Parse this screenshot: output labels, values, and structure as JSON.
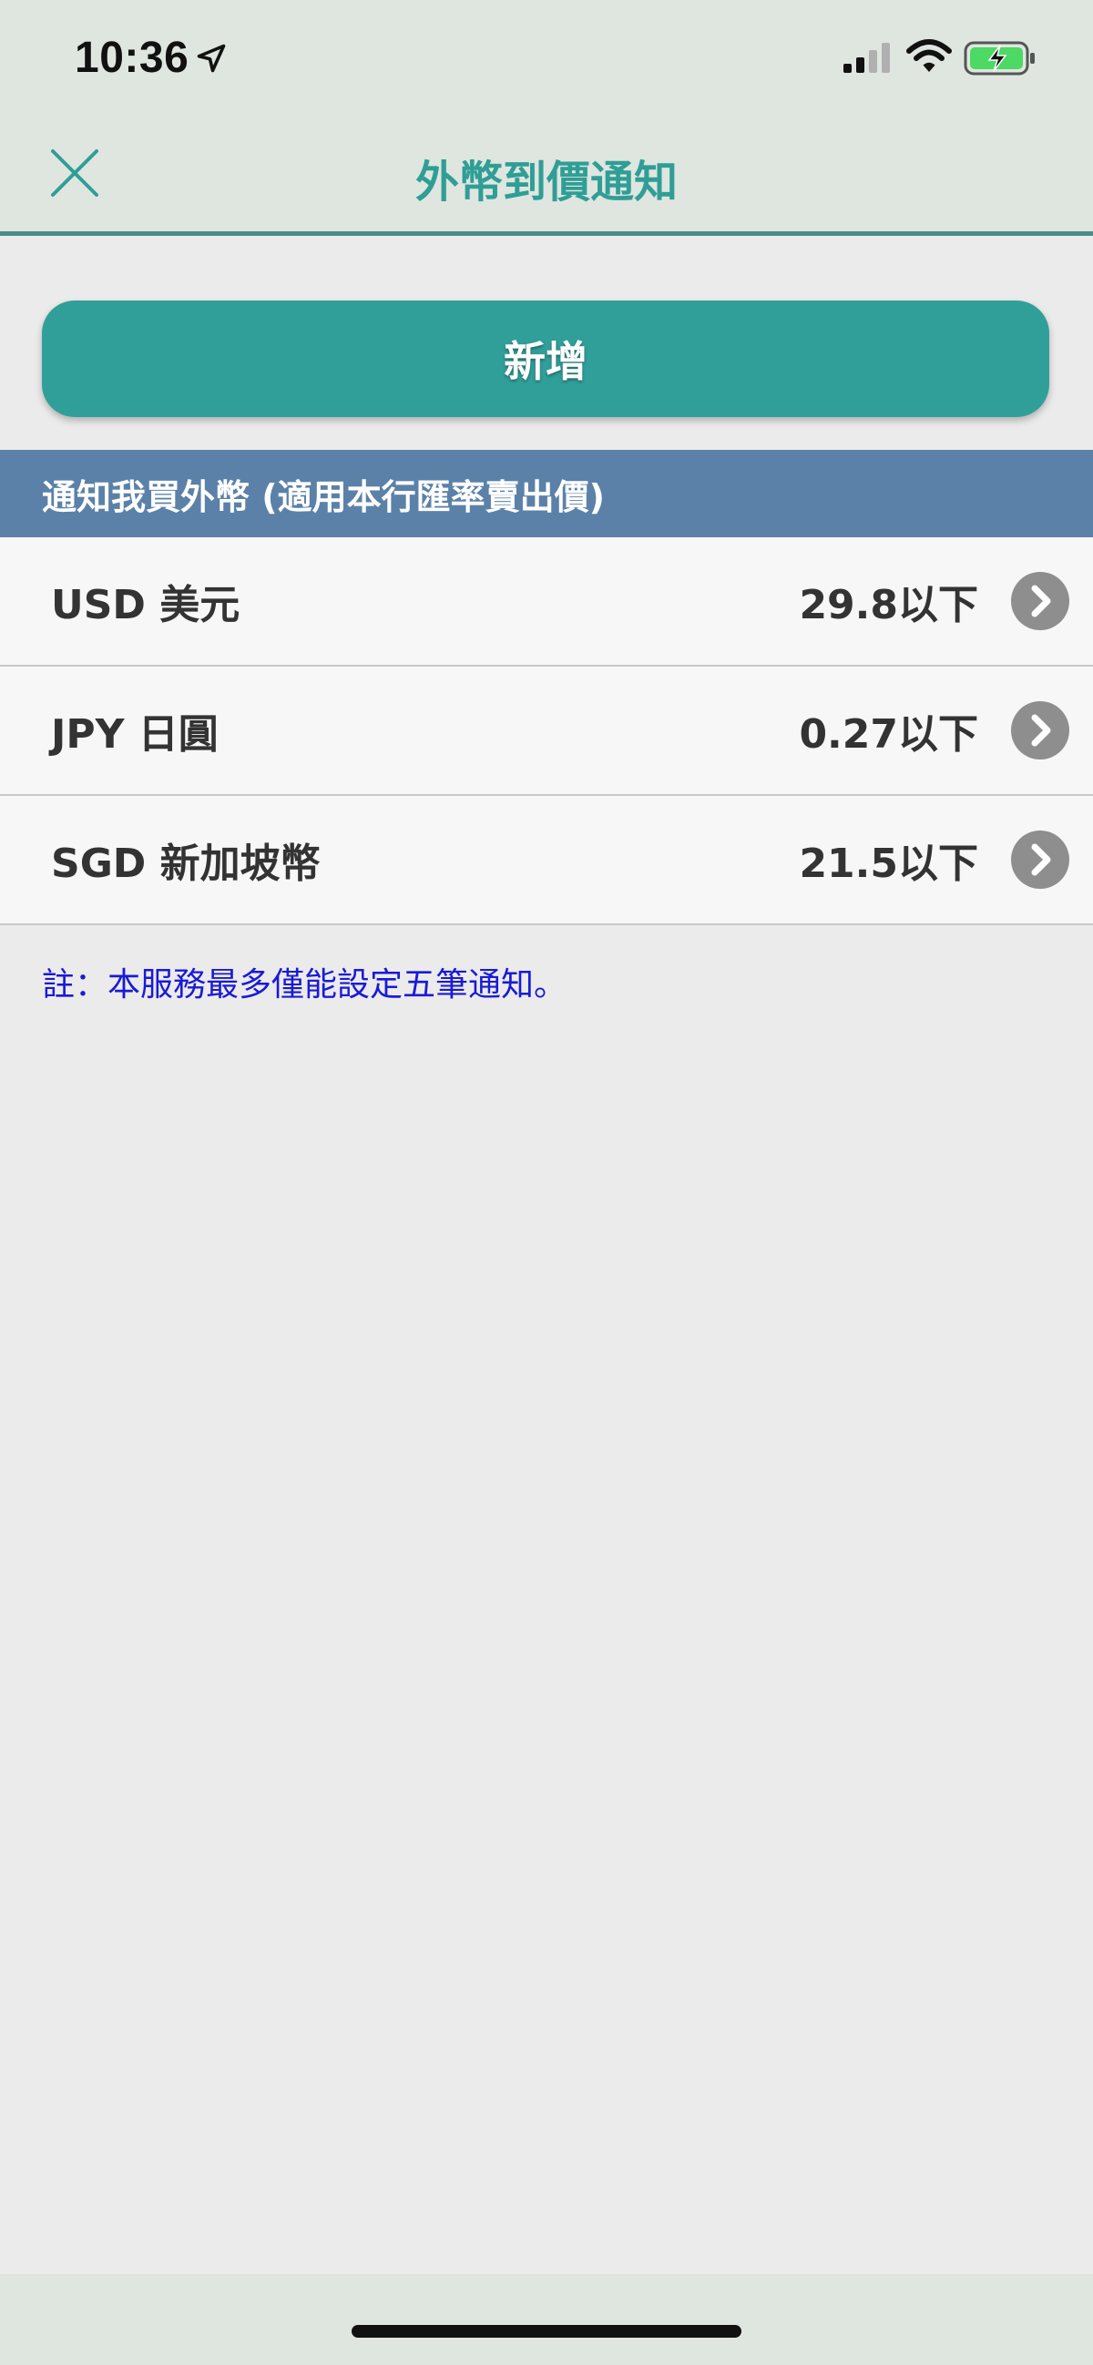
{
  "status_bar": {
    "time": "10:36"
  },
  "header": {
    "title": "外幣到價通知",
    "close_icon": "close-icon"
  },
  "add_button": {
    "label": "新增"
  },
  "section": {
    "title": "通知我買外幣 (適用本行匯率賣出價)"
  },
  "alerts": [
    {
      "currency": "USD 美元",
      "threshold": "29.8以下"
    },
    {
      "currency": "JPY 日圓",
      "threshold": "0.27以下"
    },
    {
      "currency": "SGD 新加坡幣",
      "threshold": "21.5以下"
    }
  ],
  "note": "註：本服務最多僅能設定五筆通知。",
  "colors": {
    "accent": "#319f99",
    "title": "#2f9e96",
    "section_header": "#5b81a8",
    "note": "#1a1ad6"
  }
}
